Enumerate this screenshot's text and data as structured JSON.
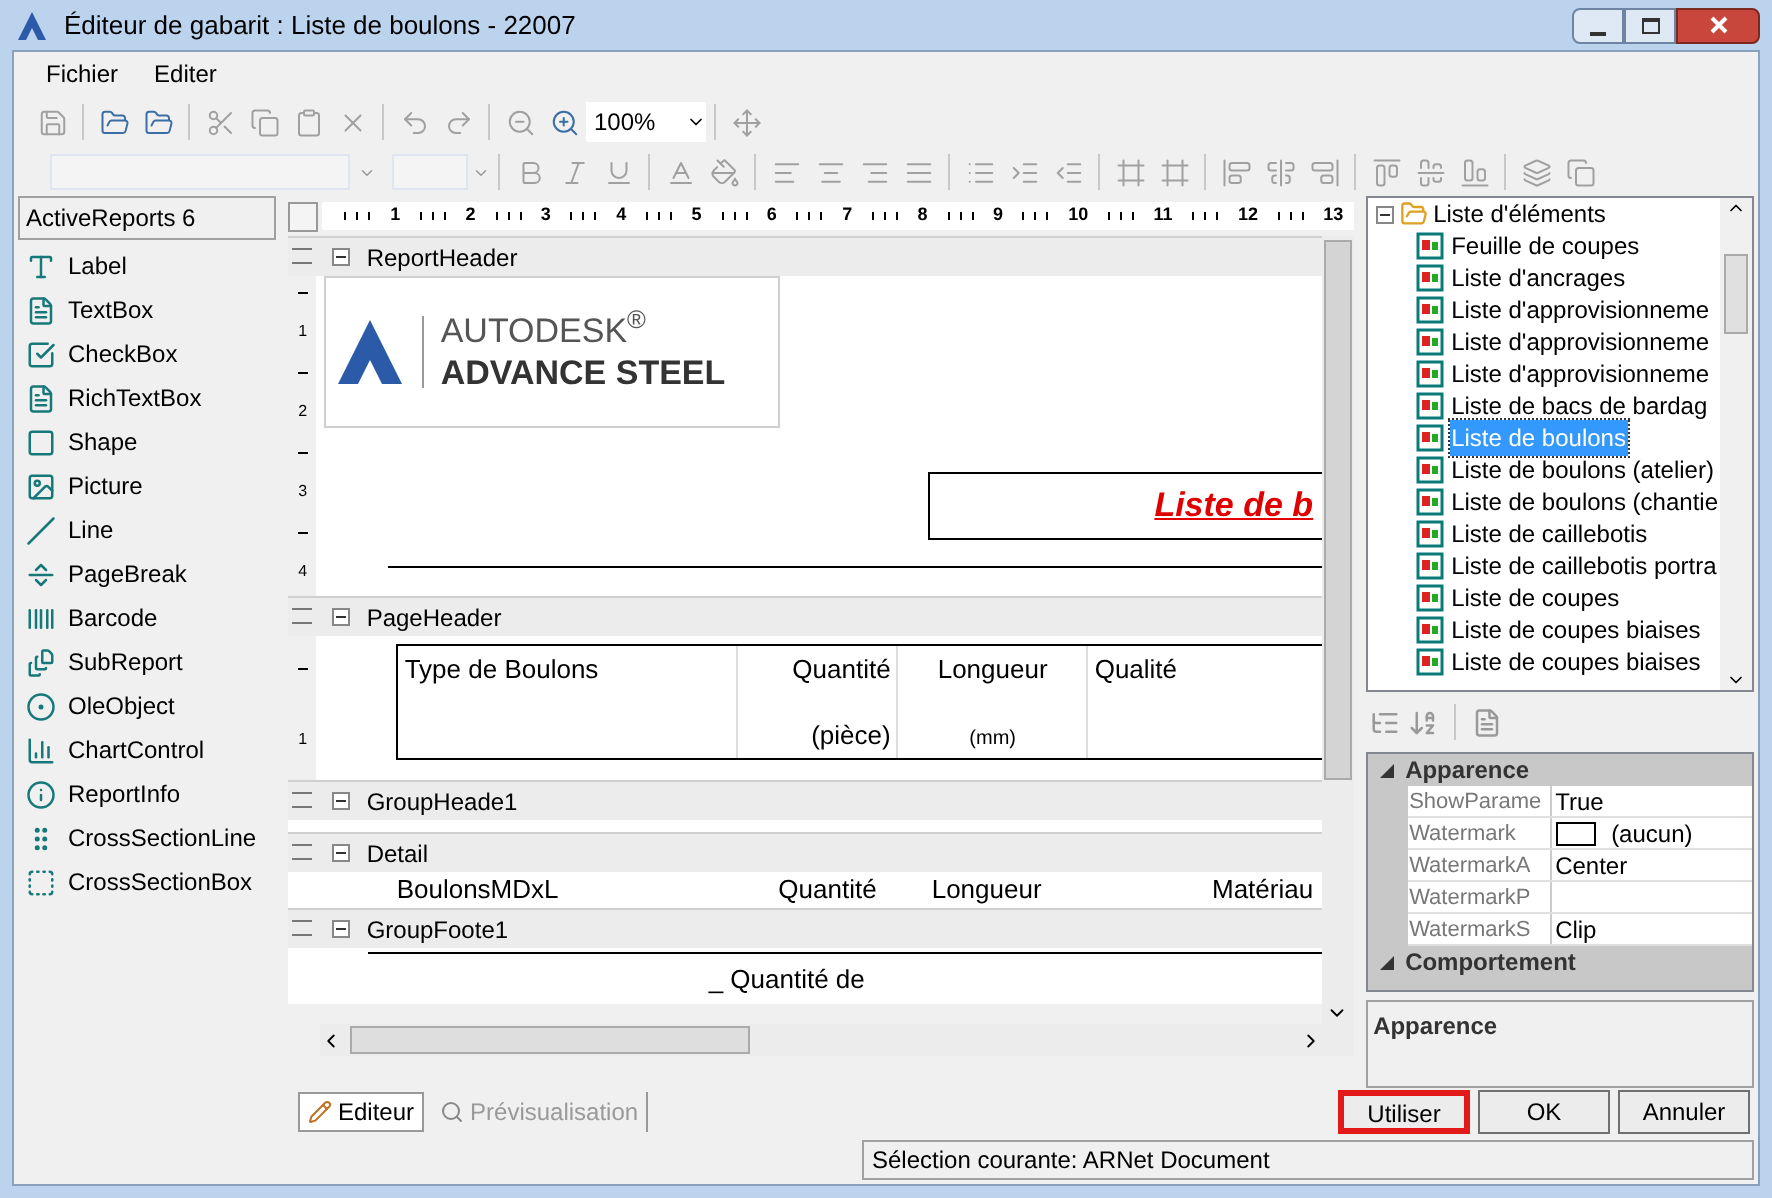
{
  "window": {
    "title": "Éditeur de gabarit : Liste de boulons - 22007"
  },
  "menu": [
    "Fichier",
    "Editer"
  ],
  "toolbar": {
    "zoom": "100%"
  },
  "toolbox": {
    "title": "ActiveReports 6",
    "items": [
      {
        "label": "Label",
        "kind": "label"
      },
      {
        "label": "TextBox",
        "kind": "textbox"
      },
      {
        "label": "CheckBox",
        "kind": "checkbox"
      },
      {
        "label": "RichTextBox",
        "kind": "richtext"
      },
      {
        "label": "Shape",
        "kind": "shape"
      },
      {
        "label": "Picture",
        "kind": "picture"
      },
      {
        "label": "Line",
        "kind": "line"
      },
      {
        "label": "PageBreak",
        "kind": "pagebreak"
      },
      {
        "label": "Barcode",
        "kind": "barcode"
      },
      {
        "label": "SubReport",
        "kind": "subreport"
      },
      {
        "label": "OleObject",
        "kind": "ole"
      },
      {
        "label": "ChartControl",
        "kind": "chart"
      },
      {
        "label": "ReportInfo",
        "kind": "info"
      },
      {
        "label": "CrossSectionLine",
        "kind": "csline"
      },
      {
        "label": "CrossSectionBox",
        "kind": "csbox"
      }
    ]
  },
  "ruler": [
    "1",
    "2",
    "3",
    "4",
    "5",
    "6",
    "7",
    "8",
    "9",
    "10",
    "11",
    "12",
    "13"
  ],
  "sections": [
    {
      "name": "ReportHeader",
      "expanded": true,
      "kind": "report_header",
      "ruler": [
        "1",
        "2",
        "3",
        "4"
      ],
      "logo": [
        "AUTODESK$^{®}$",
        "ADVANCE STEEL"
      ],
      "title": "Liste de b"
    },
    {
      "name": "PageHeader",
      "expanded": true,
      "kind": "table_header",
      "ruler": [
        "1"
      ],
      "columns": [
        {
          "title": "Type de Boulons"
        },
        {
          "title": "Quantité",
          "unit": "(pièce)"
        },
        {
          "title": "Longueur",
          "unit": "(mm)"
        },
        {
          "title": "Qualité"
        }
      ]
    },
    {
      "name": "GroupHeade1",
      "expanded": true,
      "kind": "empty"
    },
    {
      "name": "Detail",
      "expanded": true,
      "kind": "fields",
      "fields": [
        "BoulonsMDxL",
        "Quantité",
        "Longueur",
        "Matériau"
      ]
    },
    {
      "name": "GroupFoote1",
      "expanded": true,
      "kind": "footer",
      "fields": [
        "_ Quantité de"
      ]
    }
  ],
  "tree": {
    "label": "Liste d'éléments",
    "expanded": true,
    "children": [
      {
        "label": "Feuille de coupes",
        "selected": false
      },
      {
        "label": "Liste d'ancrages",
        "selected": false
      },
      {
        "label": "Liste d'approvisionneme",
        "selected": false
      },
      {
        "label": "Liste d'approvisionneme",
        "selected": false
      },
      {
        "label": "Liste d'approvisionneme",
        "selected": false
      },
      {
        "label": "Liste de bacs de bardag",
        "selected": false
      },
      {
        "label": "Liste de boulons",
        "selected": true
      },
      {
        "label": "Liste de boulons (atelier)",
        "selected": false
      },
      {
        "label": "Liste de boulons (chantie",
        "selected": false
      },
      {
        "label": "Liste de caillebotis",
        "selected": false
      },
      {
        "label": "Liste de caillebotis portra",
        "selected": false
      },
      {
        "label": "Liste de coupes",
        "selected": false
      },
      {
        "label": "Liste de coupes biaises",
        "selected": false
      },
      {
        "label": "Liste de coupes biaises",
        "selected": false
      }
    ]
  },
  "properties": {
    "categories": [
      {
        "name": "Apparence",
        "expanded": true,
        "rows": [
          {
            "name": "ShowParame",
            "value": "True",
            "kind": "text"
          },
          {
            "name": "Watermark",
            "value": "(aucun)",
            "kind": "color"
          },
          {
            "name": "WatermarkA",
            "value": "Center",
            "kind": "text"
          },
          {
            "name": "WatermarkP",
            "kind": "text"
          },
          {
            "name": "WatermarkS",
            "value": "Clip",
            "kind": "text"
          }
        ]
      },
      {
        "name": "Comportement",
        "expanded": true
      }
    ],
    "description": "Apparence"
  },
  "tabs": [
    {
      "label": "Editeur",
      "selected": true
    },
    {
      "label": "Prévisualisation",
      "selected": false
    }
  ],
  "buttons": [
    {
      "label": "Utiliser",
      "highlighted": true
    },
    {
      "label": "OK",
      "highlighted": false
    },
    {
      "label": "Annuler",
      "highlighted": false
    }
  ],
  "status_bar": "Sélection courante: ARNet Document"
}
